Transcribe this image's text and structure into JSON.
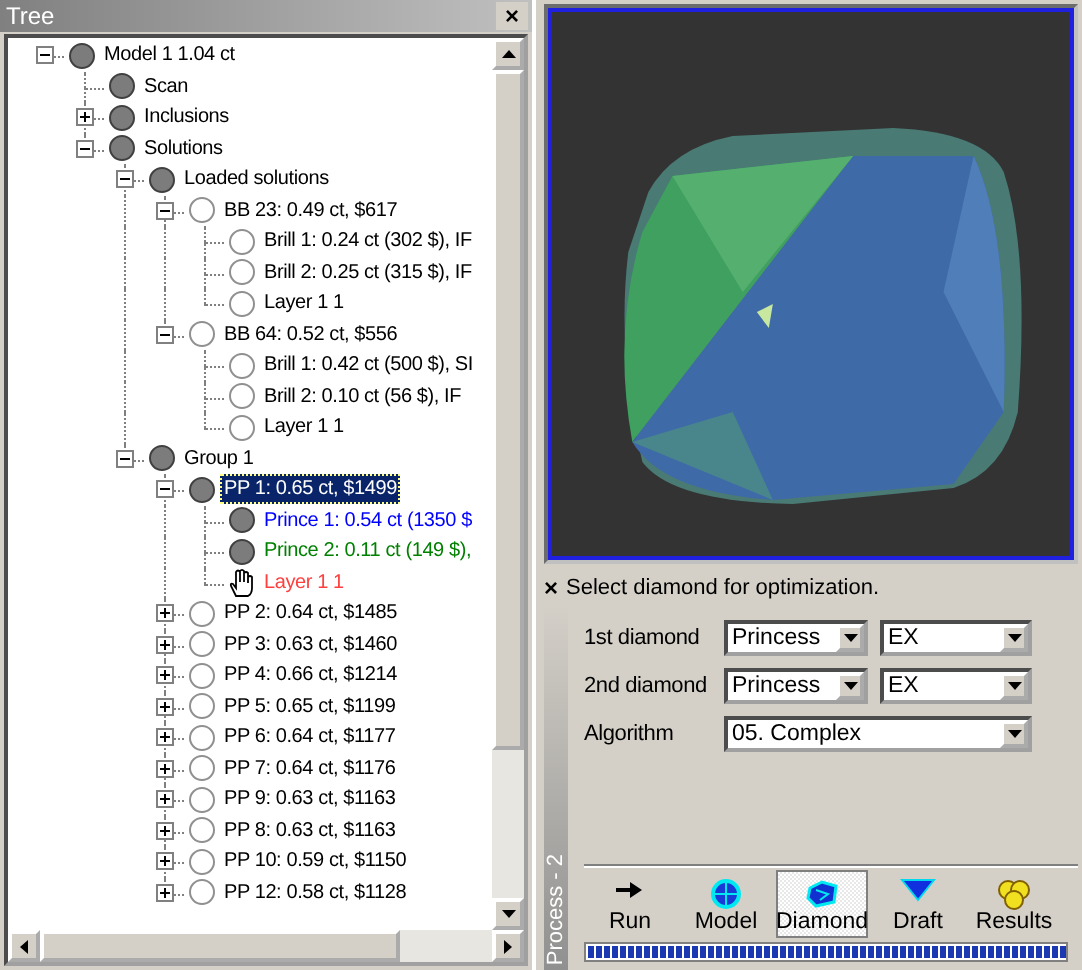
{
  "tree_panel": {
    "title": "Tree",
    "close": "×"
  },
  "tree": [
    {
      "label": "Model 1 1.04 ct",
      "kind": "filled",
      "expanded": true,
      "selected": false,
      "children": [
        {
          "label": "Scan",
          "kind": "filled",
          "selected": false
        },
        {
          "label": "Inclusions",
          "kind": "filled",
          "expanded": false,
          "selected": false
        },
        {
          "label": "Solutions",
          "kind": "filled",
          "expanded": true,
          "selected": false,
          "children": [
            {
              "label": "Loaded solutions",
              "kind": "filled",
              "expanded": true,
              "selected": false,
              "children": [
                {
                  "label": "BB 23: 0.49 ct,  $617",
                  "kind": "empty",
                  "expanded": true,
                  "selected": false,
                  "children": [
                    {
                      "label": "Brill 1: 0.24 ct (302 $), IF",
                      "kind": "empty",
                      "selected": false
                    },
                    {
                      "label": "Brill 2: 0.25 ct (315 $), IF",
                      "kind": "empty",
                      "selected": false
                    },
                    {
                      "label": "Layer 1 1",
                      "kind": "empty",
                      "selected": false
                    }
                  ]
                },
                {
                  "label": "BB 64: 0.52 ct,  $556",
                  "kind": "empty",
                  "expanded": true,
                  "selected": false,
                  "children": [
                    {
                      "label": "Brill 1: 0.42 ct (500 $), SI",
                      "kind": "empty",
                      "selected": false
                    },
                    {
                      "label": "Brill 2: 0.10 ct (56 $), IF",
                      "kind": "empty",
                      "selected": false
                    },
                    {
                      "label": "Layer 1 1",
                      "kind": "empty",
                      "selected": false
                    }
                  ]
                }
              ]
            },
            {
              "label": "Group 1",
              "kind": "filled",
              "expanded": true,
              "selected": false,
              "children": [
                {
                  "label": "PP 1: 0.65 ct,  $1499",
                  "kind": "filled",
                  "expanded": true,
                  "selected": true,
                  "children": [
                    {
                      "label": "Prince 1: 0.54 ct (1350 $",
                      "kind": "filled",
                      "selected": false,
                      "color": "#0000ff"
                    },
                    {
                      "label": "Prince 2: 0.11 ct (149 $),",
                      "kind": "filled",
                      "selected": false,
                      "color": "#008000"
                    },
                    {
                      "label": "Layer 1 1",
                      "kind": "hand",
                      "selected": false,
                      "color": "#ff4040"
                    }
                  ]
                },
                {
                  "label": "PP 2: 0.64 ct,  $1485",
                  "kind": "empty",
                  "expanded": false,
                  "selected": false
                },
                {
                  "label": "PP 3: 0.63 ct,  $1460",
                  "kind": "empty",
                  "expanded": false,
                  "selected": false
                },
                {
                  "label": "PP 4: 0.66 ct,  $1214",
                  "kind": "empty",
                  "expanded": false,
                  "selected": false
                },
                {
                  "label": "PP 5: 0.65 ct,  $1199",
                  "kind": "empty",
                  "expanded": false,
                  "selected": false
                },
                {
                  "label": "PP 6: 0.64 ct,  $1177",
                  "kind": "empty",
                  "expanded": false,
                  "selected": false
                },
                {
                  "label": "PP 7: 0.64 ct,  $1176",
                  "kind": "empty",
                  "expanded": false,
                  "selected": false
                },
                {
                  "label": "PP 9: 0.63 ct,  $1163",
                  "kind": "empty",
                  "expanded": false,
                  "selected": false
                },
                {
                  "label": "PP 8: 0.63 ct,  $1163",
                  "kind": "empty",
                  "expanded": false,
                  "selected": false
                },
                {
                  "label": "PP 10: 0.59 ct,  $1150",
                  "kind": "empty",
                  "expanded": false,
                  "selected": false
                },
                {
                  "label": "PP 12: 0.58 ct,  $1128",
                  "kind": "empty",
                  "expanded": false,
                  "selected": false
                }
              ]
            }
          ]
        }
      ]
    }
  ],
  "process": {
    "close": "×",
    "title": "Select diamond for optimization.",
    "side_label": "Process - 2",
    "fields": [
      {
        "label": "1st diamond",
        "values": [
          "Princess",
          "EX"
        ]
      },
      {
        "label": "2nd diamond",
        "values": [
          "Princess",
          "EX"
        ]
      },
      {
        "label": "Algorithm",
        "values": [
          "05. Complex"
        ]
      }
    ],
    "toolbar": [
      {
        "label": "Run",
        "kind": "run",
        "selected": false
      },
      {
        "label": "Model",
        "kind": "model",
        "selected": false
      },
      {
        "label": "Diamond",
        "kind": "diamond",
        "selected": true
      },
      {
        "label": "Draft",
        "kind": "draft",
        "selected": false
      },
      {
        "label": "Results",
        "kind": "results",
        "selected": false
      }
    ],
    "progress": {
      "level": 1
    }
  }
}
